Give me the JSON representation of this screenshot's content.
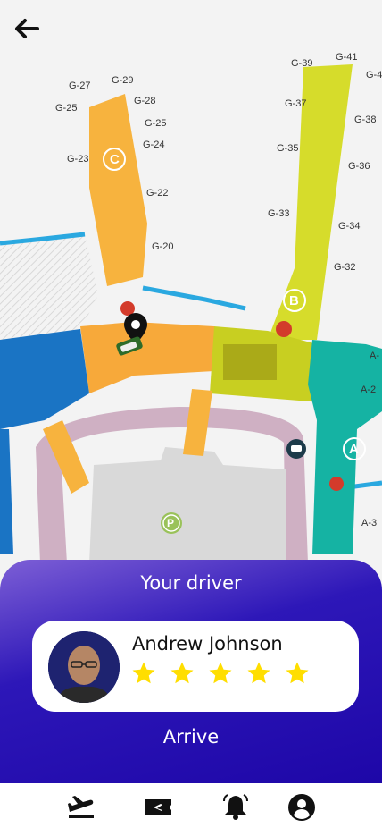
{
  "map": {
    "gates": [
      "G-27",
      "G-29",
      "G-28",
      "G-25",
      "G-25",
      "G-24",
      "G-23",
      "G-22",
      "G-20",
      "G-39",
      "G-41",
      "G-4",
      "G-37",
      "G-38",
      "G-35",
      "G-36",
      "G-33",
      "G-34",
      "G-32",
      "A-",
      "A-2",
      "A-3"
    ],
    "concourse_labels": [
      "C",
      "B",
      "A"
    ],
    "parking_label": "P",
    "colors": {
      "concourse_c": "#f7b33e",
      "concourse_b": "#d6dc2b",
      "concourse_a": "#15b3a3",
      "terminal_blue": "#1a74c4",
      "road": "#c9a9bd"
    }
  },
  "driver_panel": {
    "title": "Your driver",
    "driver_name": "Andrew Johnson",
    "rating": 5,
    "rating_max": 5,
    "action": "Arrive"
  },
  "tabs": [
    {
      "icon": "flight-departure-icon"
    },
    {
      "icon": "ticket-icon"
    },
    {
      "icon": "bell-icon"
    },
    {
      "icon": "account-icon"
    }
  ],
  "icons": {
    "back": "back-arrow-icon",
    "pin": "location-pin-icon",
    "car": "car-icon"
  }
}
